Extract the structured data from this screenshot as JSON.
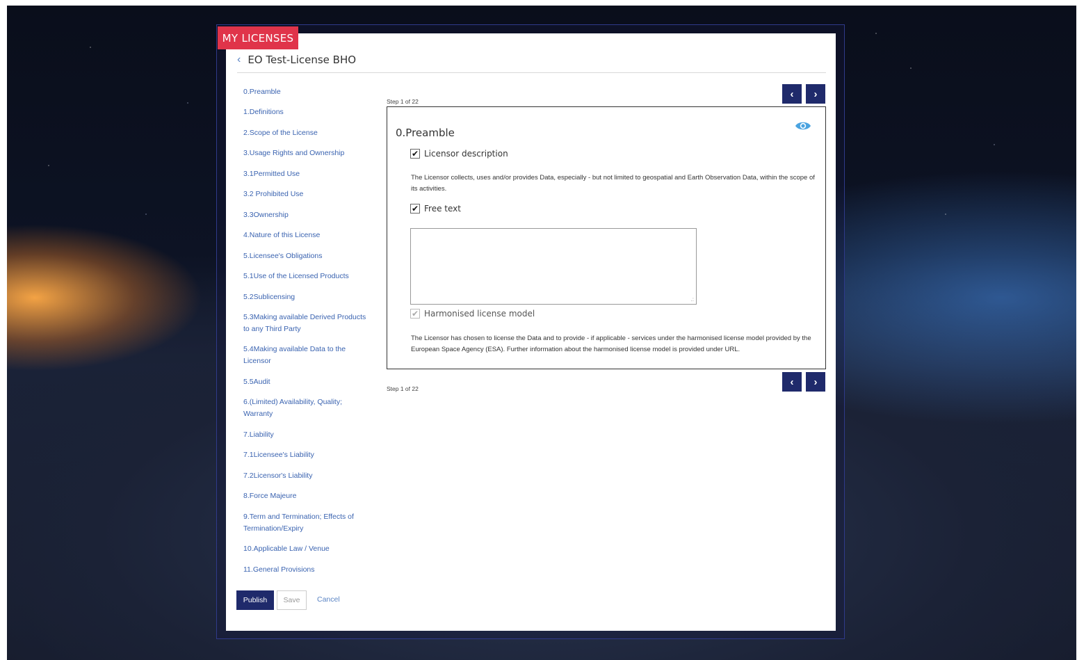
{
  "header": {
    "section_tag": "MY LICENSES",
    "license_name": "EO Test-License BHO",
    "back_icon": "chevron-left-icon"
  },
  "sidebar": {
    "items": [
      "0.Preamble",
      "1.Definitions",
      "2.Scope of the License",
      "3.Usage Rights and Ownership",
      "3.1Permitted Use",
      "3.2 Prohibited Use",
      "3.3Ownership",
      "4.Nature of this License",
      "5.Licensee's Obligations",
      "5.1Use of the Licensed Products",
      "5.2Sublicensing",
      "5.3Making available Derived Products to any Third Party",
      "5.4Making available Data to the Licensor",
      "5.5Audit",
      "6.(Limited) Availability, Quality; Warranty",
      "7.Liability",
      "7.1Licensee's Liability",
      "7.2Licensor's Liability",
      "8.Force Majeure",
      "9.Term and Termination; Effects of Termination/Expiry",
      "10.Applicable Law / Venue",
      "11.General Provisions"
    ]
  },
  "stepper": {
    "label": "Step 1 of 22",
    "prev_icon": "chevron-left-icon",
    "next_icon": "chevron-right-icon"
  },
  "content": {
    "title": "0.Preamble",
    "eye_icon": "eye-icon",
    "licensor_description": {
      "label": "Licensor description",
      "checked": true,
      "text": "The Licensor collects, uses and/or provides Data, especially - but not limited to geospatial and Earth Observation Data, within the scope of its activities."
    },
    "free_text": {
      "label": "Free text",
      "checked": true,
      "value": ""
    },
    "harmonised": {
      "label": "Harmonised license model",
      "checked": true,
      "disabled": true,
      "text": "The Licensor has chosen to license the Data and to provide - if applicable - services under the harmonised license model provided by the European Space Agency (ESA). Further information about the harmonised license model is provided under URL."
    }
  },
  "actions": {
    "publish": "Publish",
    "save": "Save",
    "cancel": "Cancel"
  },
  "colors": {
    "accent": "#1f2a6b",
    "tag": "#e0344a",
    "link": "#3a63b0"
  }
}
